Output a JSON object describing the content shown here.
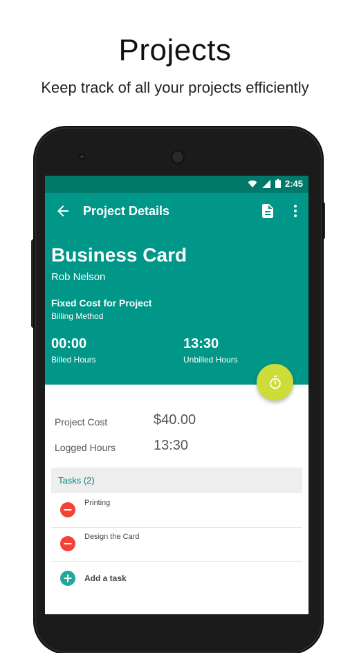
{
  "hero": {
    "title": "Projects",
    "subtitle": "Keep track of all your projects efficiently"
  },
  "status_bar": {
    "time": "2:45",
    "icons": [
      "wifi-icon",
      "signal-icon",
      "battery-icon"
    ]
  },
  "app_bar": {
    "title": "Project Details",
    "back_icon": "arrow-back-icon",
    "actions": [
      "document-icon",
      "more-vert-icon"
    ]
  },
  "project": {
    "name": "Business Card",
    "client": "Rob Nelson",
    "billing_method_value": "Fixed Cost for Project",
    "billing_method_label": "Billing Method",
    "billed_hours_value": "00:00",
    "billed_hours_label": "Billed Hours",
    "unbilled_hours_value": "13:30",
    "unbilled_hours_label": "Unbilled Hours"
  },
  "summary": {
    "project_cost_label": "Project Cost",
    "project_cost_value": "$40.00",
    "logged_hours_label": "Logged Hours",
    "logged_hours_value": "13:30"
  },
  "tasks": {
    "header": "Tasks (2)",
    "items": [
      {
        "label": "Printing"
      },
      {
        "label": "Design the Card"
      }
    ],
    "add_label": "Add a task"
  },
  "colors": {
    "primary": "#009688",
    "primary_dark": "#00796b",
    "accent": "#cddc39",
    "remove": "#f44336",
    "add": "#26a69a"
  }
}
